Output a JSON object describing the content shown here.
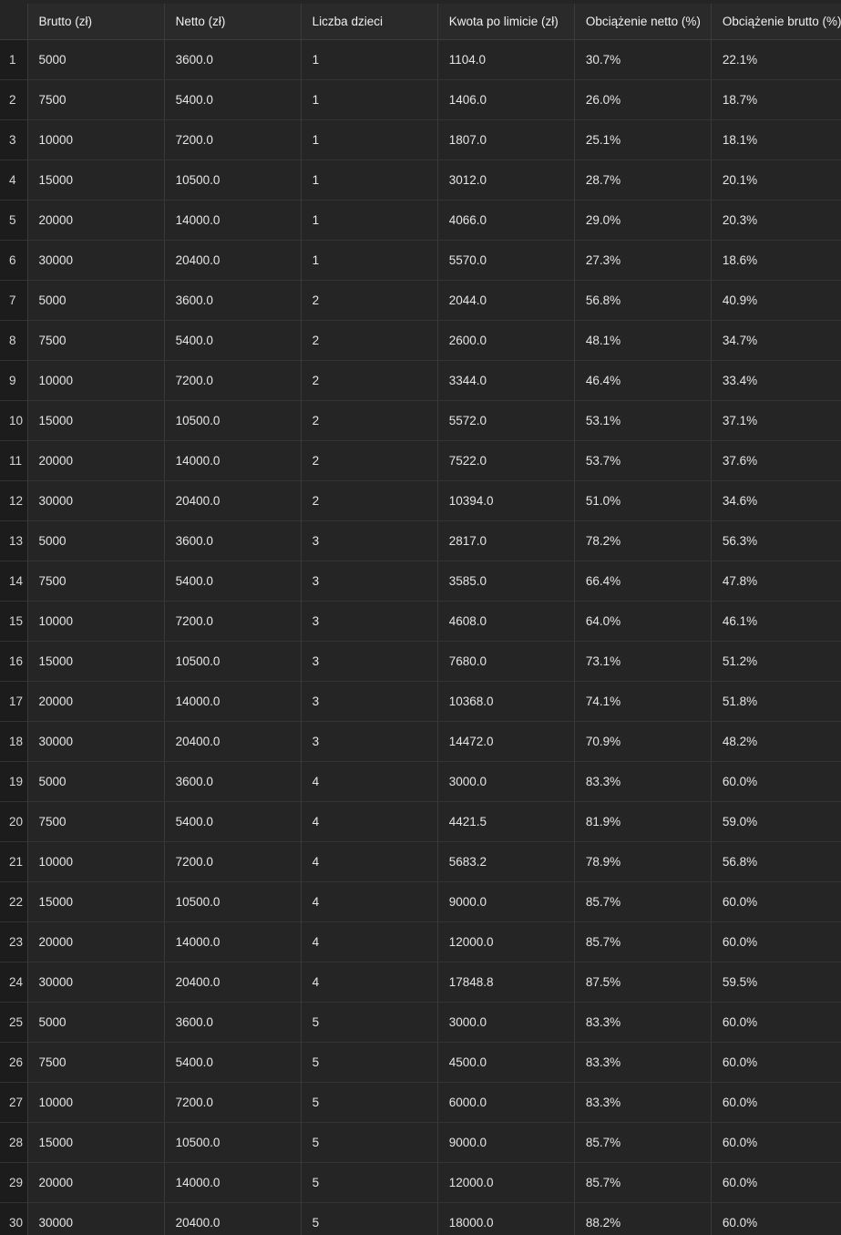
{
  "table": {
    "columns": [
      "Brutto (zł)",
      "Netto (zł)",
      "Liczba dzieci",
      "Kwota po limicie (zł)",
      "Obciążenie netto (%)",
      "Obciążenie brutto (%)"
    ],
    "rows": [
      {
        "index": "1",
        "cells": [
          "5000",
          "3600.0",
          "1",
          "1104.0",
          "30.7%",
          "22.1%"
        ]
      },
      {
        "index": "2",
        "cells": [
          "7500",
          "5400.0",
          "1",
          "1406.0",
          "26.0%",
          "18.7%"
        ]
      },
      {
        "index": "3",
        "cells": [
          "10000",
          "7200.0",
          "1",
          "1807.0",
          "25.1%",
          "18.1%"
        ]
      },
      {
        "index": "4",
        "cells": [
          "15000",
          "10500.0",
          "1",
          "3012.0",
          "28.7%",
          "20.1%"
        ]
      },
      {
        "index": "5",
        "cells": [
          "20000",
          "14000.0",
          "1",
          "4066.0",
          "29.0%",
          "20.3%"
        ]
      },
      {
        "index": "6",
        "cells": [
          "30000",
          "20400.0",
          "1",
          "5570.0",
          "27.3%",
          "18.6%"
        ]
      },
      {
        "index": "7",
        "cells": [
          "5000",
          "3600.0",
          "2",
          "2044.0",
          "56.8%",
          "40.9%"
        ]
      },
      {
        "index": "8",
        "cells": [
          "7500",
          "5400.0",
          "2",
          "2600.0",
          "48.1%",
          "34.7%"
        ]
      },
      {
        "index": "9",
        "cells": [
          "10000",
          "7200.0",
          "2",
          "3344.0",
          "46.4%",
          "33.4%"
        ]
      },
      {
        "index": "10",
        "cells": [
          "15000",
          "10500.0",
          "2",
          "5572.0",
          "53.1%",
          "37.1%"
        ]
      },
      {
        "index": "11",
        "cells": [
          "20000",
          "14000.0",
          "2",
          "7522.0",
          "53.7%",
          "37.6%"
        ]
      },
      {
        "index": "12",
        "cells": [
          "30000",
          "20400.0",
          "2",
          "10394.0",
          "51.0%",
          "34.6%"
        ]
      },
      {
        "index": "13",
        "cells": [
          "5000",
          "3600.0",
          "3",
          "2817.0",
          "78.2%",
          "56.3%"
        ]
      },
      {
        "index": "14",
        "cells": [
          "7500",
          "5400.0",
          "3",
          "3585.0",
          "66.4%",
          "47.8%"
        ]
      },
      {
        "index": "15",
        "cells": [
          "10000",
          "7200.0",
          "3",
          "4608.0",
          "64.0%",
          "46.1%"
        ]
      },
      {
        "index": "16",
        "cells": [
          "15000",
          "10500.0",
          "3",
          "7680.0",
          "73.1%",
          "51.2%"
        ]
      },
      {
        "index": "17",
        "cells": [
          "20000",
          "14000.0",
          "3",
          "10368.0",
          "74.1%",
          "51.8%"
        ]
      },
      {
        "index": "18",
        "cells": [
          "30000",
          "20400.0",
          "3",
          "14472.0",
          "70.9%",
          "48.2%"
        ]
      },
      {
        "index": "19",
        "cells": [
          "5000",
          "3600.0",
          "4",
          "3000.0",
          "83.3%",
          "60.0%"
        ]
      },
      {
        "index": "20",
        "cells": [
          "7500",
          "5400.0",
          "4",
          "4421.5",
          "81.9%",
          "59.0%"
        ]
      },
      {
        "index": "21",
        "cells": [
          "10000",
          "7200.0",
          "4",
          "5683.2",
          "78.9%",
          "56.8%"
        ]
      },
      {
        "index": "22",
        "cells": [
          "15000",
          "10500.0",
          "4",
          "9000.0",
          "85.7%",
          "60.0%"
        ]
      },
      {
        "index": "23",
        "cells": [
          "20000",
          "14000.0",
          "4",
          "12000.0",
          "85.7%",
          "60.0%"
        ]
      },
      {
        "index": "24",
        "cells": [
          "30000",
          "20400.0",
          "4",
          "17848.8",
          "87.5%",
          "59.5%"
        ]
      },
      {
        "index": "25",
        "cells": [
          "5000",
          "3600.0",
          "5",
          "3000.0",
          "83.3%",
          "60.0%"
        ]
      },
      {
        "index": "26",
        "cells": [
          "7500",
          "5400.0",
          "5",
          "4500.0",
          "83.3%",
          "60.0%"
        ]
      },
      {
        "index": "27",
        "cells": [
          "10000",
          "7200.0",
          "5",
          "6000.0",
          "83.3%",
          "60.0%"
        ]
      },
      {
        "index": "28",
        "cells": [
          "15000",
          "10500.0",
          "5",
          "9000.0",
          "85.7%",
          "60.0%"
        ]
      },
      {
        "index": "29",
        "cells": [
          "20000",
          "14000.0",
          "5",
          "12000.0",
          "85.7%",
          "60.0%"
        ]
      },
      {
        "index": "30",
        "cells": [
          "30000",
          "20400.0",
          "5",
          "18000.0",
          "88.2%",
          "60.0%"
        ]
      }
    ]
  }
}
